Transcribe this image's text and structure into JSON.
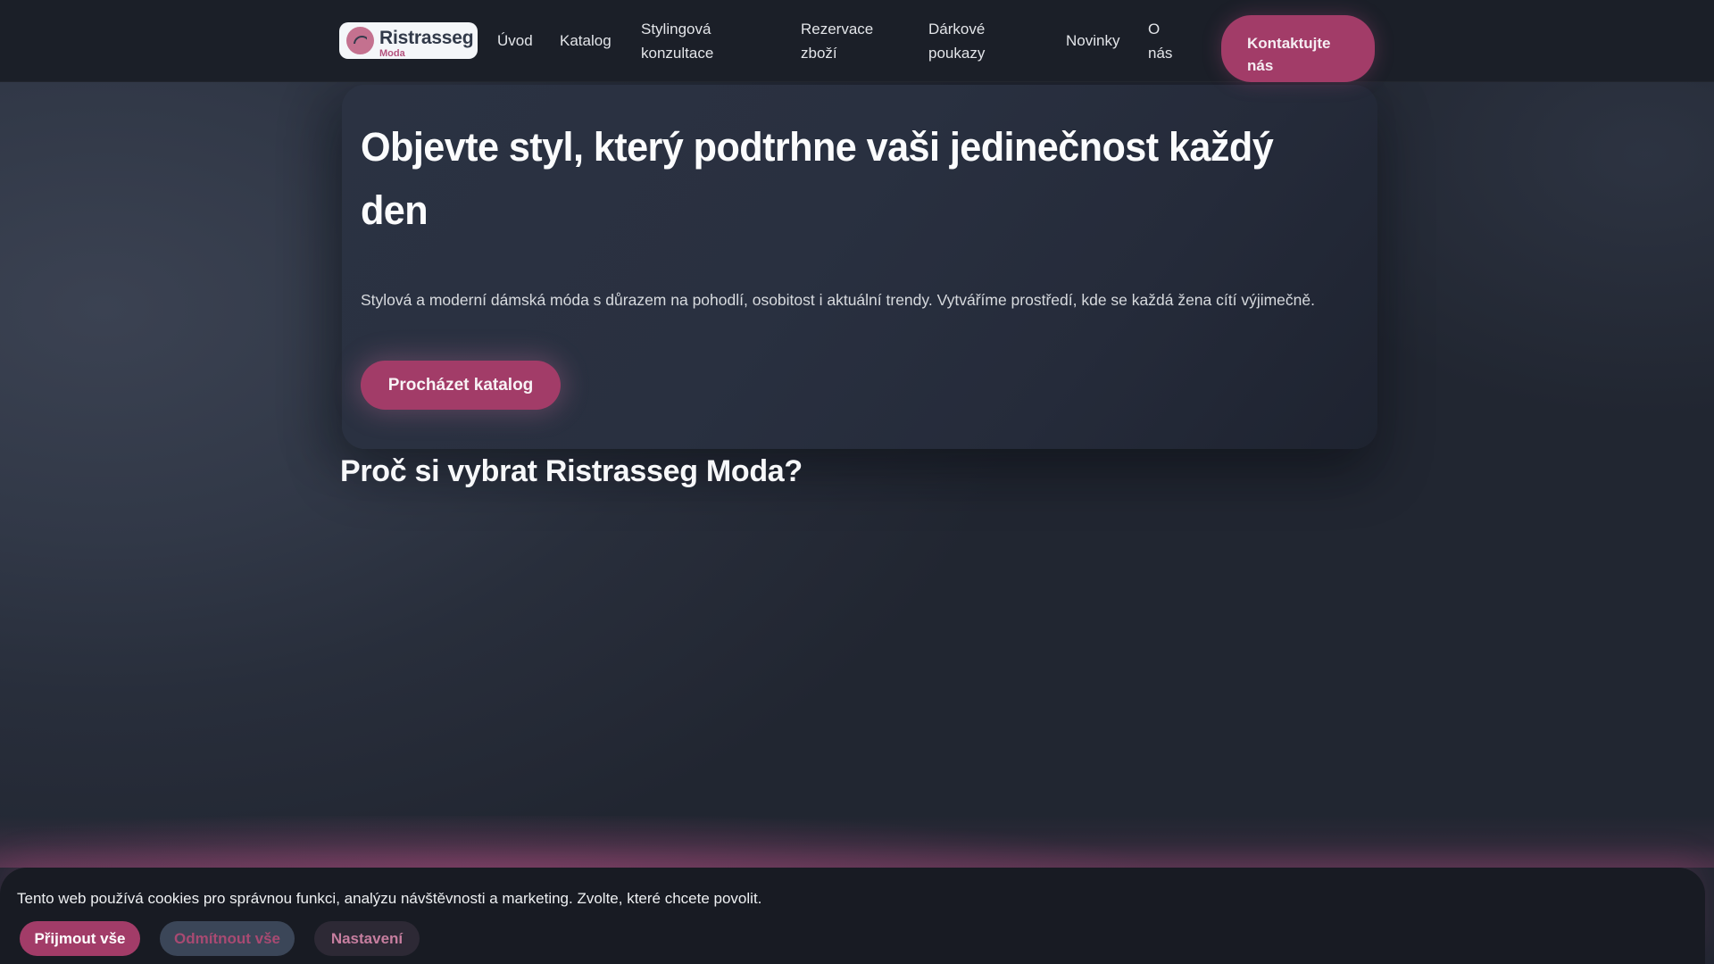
{
  "brand": {
    "name": "Ristrasseg",
    "tagline": "Moda"
  },
  "nav": {
    "links": [
      {
        "label": "Úvod"
      },
      {
        "label": "Katalog"
      },
      {
        "label": "Stylingová konzultace"
      },
      {
        "label": "Rezervace zboží"
      },
      {
        "label": "Dárkové poukazy"
      },
      {
        "label": "Novinky"
      },
      {
        "label": "O nás"
      }
    ],
    "cta_label": "Kontaktujte nás"
  },
  "hero": {
    "title_lines": [
      "Objevte styl, který podtrhne vaši jedinečnost každý",
      "den"
    ],
    "subtitle": "Stylová a moderní dámská móda s důrazem na pohodlí, osobitost i aktuální trendy. Vytváříme prostředí, kde se každá žena cítí výjimečně.",
    "cta_label": "Procházet katalog"
  },
  "section": {
    "heading": "Proč si vybrat Ristrasseg Moda?"
  },
  "cookie_banner": {
    "message": "Tento web používá cookies pro správnou funkci, analýzu návštěvnosti a marketing. Zvolte, které chcete povolit.",
    "accept_label": "Přijmout vše",
    "reject_label": "Odmítnout vše",
    "settings_label": "Nastavení"
  },
  "colors": {
    "accent": "#a23c68",
    "logo_circle": "#c4718f",
    "nav_bg": "#1b1f28",
    "hero_card_bg": "#293040",
    "cookie_bg": "#181b23"
  }
}
